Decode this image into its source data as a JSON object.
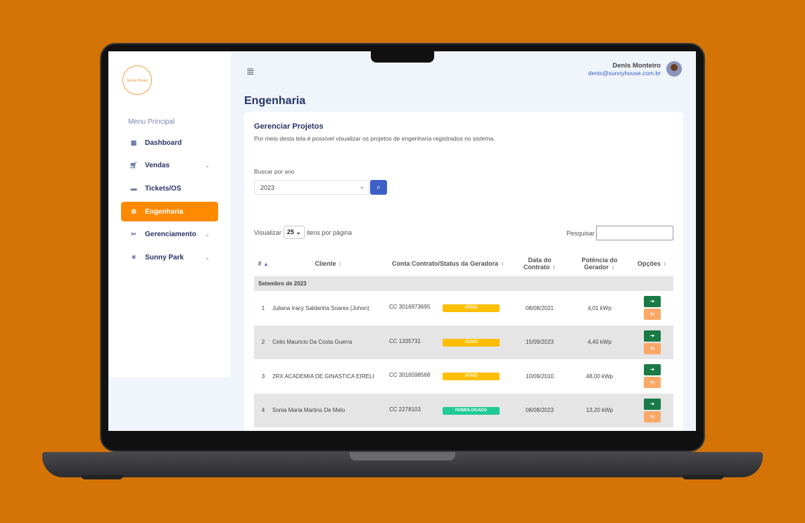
{
  "sidebar": {
    "logo_text": "Sunny House",
    "menu_title": "Menu Principal",
    "items": [
      {
        "label": "Dashboard",
        "icon": "grid-icon"
      },
      {
        "label": "Vendas",
        "icon": "cart-icon",
        "expandable": true
      },
      {
        "label": "Tickets/OS",
        "icon": "ticket-icon"
      },
      {
        "label": "Engenharia",
        "icon": "gear-icon",
        "active": true
      },
      {
        "label": "Gerenciamento",
        "icon": "tools-icon",
        "expandable": true
      },
      {
        "label": "Sunny Park",
        "icon": "sun-icon",
        "expandable": true
      }
    ]
  },
  "header": {
    "user_name": "Denis Monteiro",
    "user_email": "denis@sunnyhouse.com.br"
  },
  "page_title": "Engenharia",
  "card": {
    "title": "Gerenciar Projetos",
    "description": "Por meio desta tela é possível visualizar os projetos de engenharia registrados no sistema.",
    "year_label": "Buscar por ano",
    "year_value": "2023",
    "per_page_prefix": "Visualizar",
    "per_page_value": "25",
    "per_page_suffix": "itens por página",
    "search_label": "Pesquisar",
    "search_value": ""
  },
  "table": {
    "headers": [
      "#",
      "Cliente",
      "Conta Contrato/Status da Geradora",
      "Data do Contrato",
      "Potência do Gerador",
      "Opções"
    ],
    "group": "Setembro de 2023",
    "rows": [
      {
        "n": "1",
        "cliente": "Juliana Iracy Saldanha Soares (Johon)",
        "conta": "CC 3016973695",
        "status": "ATIVO",
        "data": "08/08/2021",
        "potencia": "4,01 kWp"
      },
      {
        "n": "2",
        "cliente": "Celio Mauricio Da Costa Guerra",
        "conta": "CC 1335731",
        "status": "ATIVO",
        "data": "15/09/2023",
        "potencia": "4,40 kWp"
      },
      {
        "n": "3",
        "cliente": "2RX ACADEMIA DE GINASTICA EIRELI",
        "conta": "CC 3016598568",
        "status": "ATIVO",
        "data": "10/09/2010",
        "potencia": "48,00 kWp"
      },
      {
        "n": "4",
        "cliente": "Sonia Maria Martins De Melo",
        "conta": "CC 2278103",
        "status": "HOMOLOGADO",
        "data": "08/08/2023",
        "potencia": "13,20 kWp"
      }
    ]
  },
  "colors": {
    "background": "#d47406",
    "accent": "#ff8a00",
    "primary": "#3d60c8",
    "ativo": "#ffbf00",
    "homologado": "#20c997",
    "go_button": "#1a7a45",
    "swap_button": "#f9a868"
  }
}
